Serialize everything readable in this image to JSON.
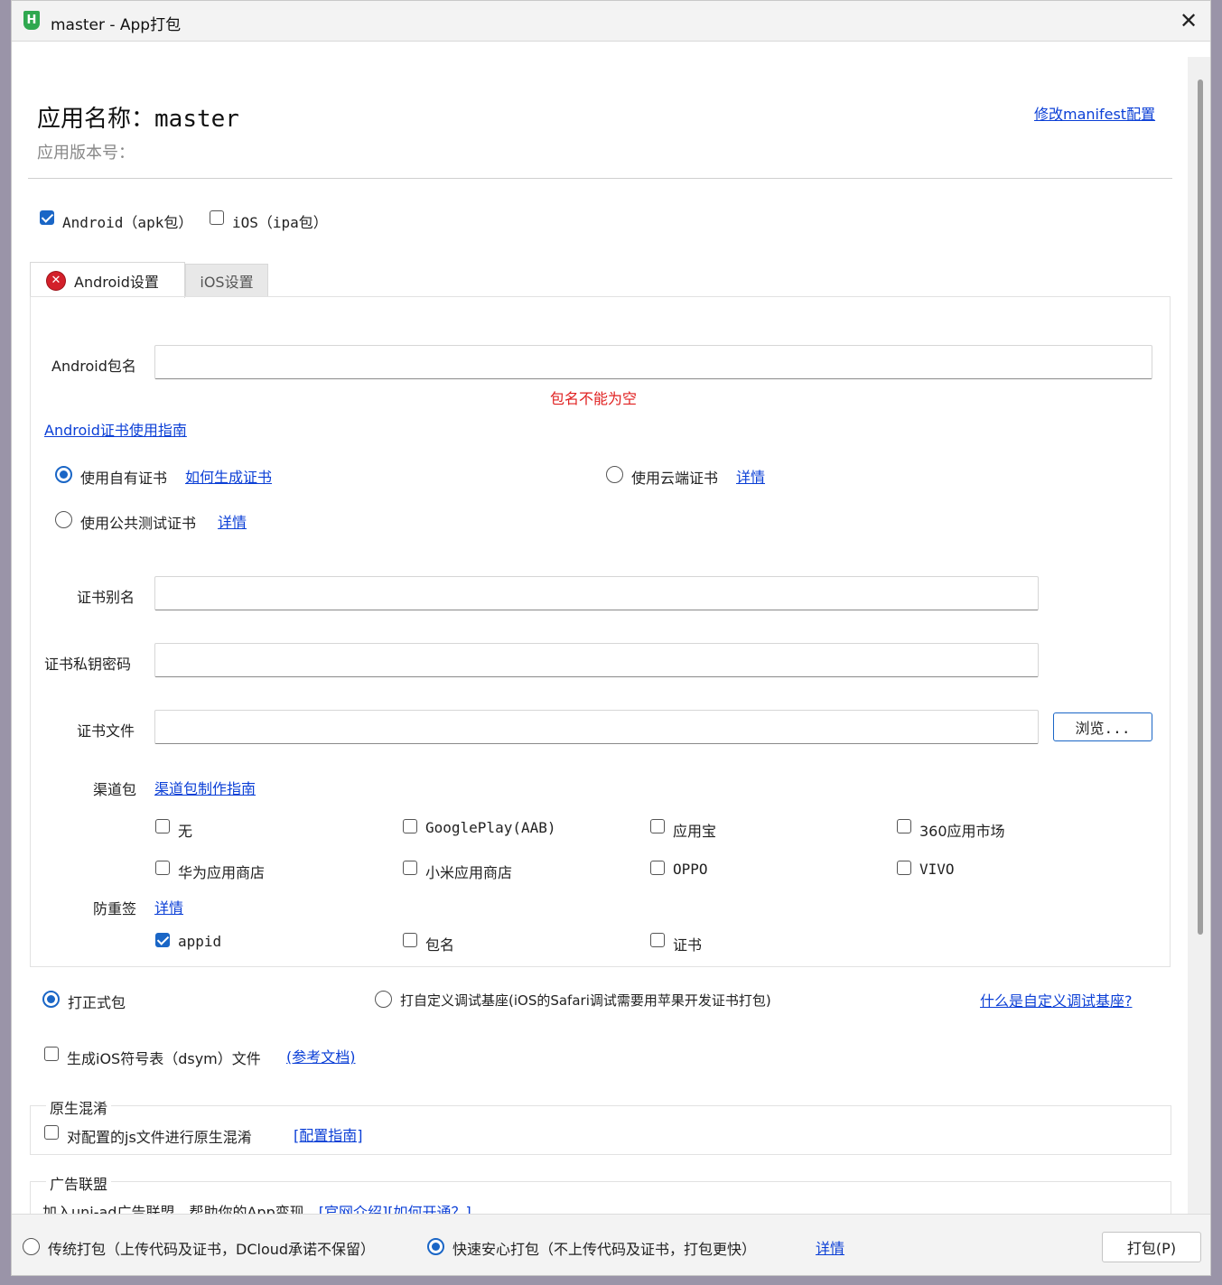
{
  "window": {
    "title": "master - App打包",
    "icon": "H",
    "close": "✕"
  },
  "header": {
    "app_name_label": "应用名称：",
    "app_name": "master",
    "version_label": "应用版本号：",
    "manifest_link": "修改manifest配置"
  },
  "platforms": {
    "android": {
      "label": "Android（apk包）",
      "checked": true
    },
    "ios": {
      "label": "iOS（ipa包）",
      "checked": false
    }
  },
  "tabs": [
    {
      "label": "Android设置",
      "active": true,
      "error_icon": "✕"
    },
    {
      "label": "iOS设置",
      "active": false
    }
  ],
  "android": {
    "package_label": "Android包名",
    "package_value": "",
    "package_error": "包名不能为空",
    "cert_guide_link": "Android证书使用指南",
    "cert_options": {
      "own": {
        "label": "使用自有证书",
        "link": "如何生成证书",
        "selected": true
      },
      "cloud": {
        "label": "使用云端证书",
        "link": "详情",
        "selected": false
      },
      "public": {
        "label": "使用公共测试证书",
        "link": "详情",
        "selected": false
      }
    },
    "alias_label": "证书别名",
    "password_label": "证书私钥密码",
    "file_label": "证书文件",
    "browse_button": "浏览...",
    "channel_label": "渠道包",
    "channel_link": "渠道包制作指南",
    "channels": [
      {
        "label": "无",
        "checked": false
      },
      {
        "label": "GooglePlay(AAB)",
        "checked": false
      },
      {
        "label": "应用宝",
        "checked": false
      },
      {
        "label": "360应用市场",
        "checked": false
      },
      {
        "label": "华为应用商店",
        "checked": false
      },
      {
        "label": "小米应用商店",
        "checked": false
      },
      {
        "label": "OPPO",
        "checked": false
      },
      {
        "label": "VIVO",
        "checked": false
      }
    ],
    "anti_resign_label": "防重签",
    "anti_resign_link": "详情",
    "anti_resign": [
      {
        "label": "appid",
        "checked": true
      },
      {
        "label": "包名",
        "checked": false
      },
      {
        "label": "证书",
        "checked": false
      }
    ]
  },
  "build_type": {
    "formal": {
      "label": "打正式包",
      "selected": true
    },
    "custom": {
      "label": "打自定义调试基座(iOS的Safari调试需要用苹果开发证书打包)",
      "selected": false
    },
    "custom_link": "什么是自定义调试基座?"
  },
  "dsym": {
    "label": "生成iOS符号表（dsym）文件",
    "link": "(参考文档)",
    "checked": false
  },
  "obfuscation": {
    "legend": "原生混淆",
    "label": "对配置的js文件进行原生混淆",
    "link": "[配置指南]",
    "checked": false
  },
  "ads": {
    "legend": "广告联盟",
    "text": "加入uni-ad广告联盟，帮助你的App变现。",
    "link1": "[官网介绍]",
    "link2": "[如何开通？]"
  },
  "footer": {
    "traditional": {
      "label": "传统打包（上传代码及证书，DCloud承诺不保留）",
      "selected": false
    },
    "fast": {
      "label": "快速安心打包（不上传代码及证书，打包更快）",
      "selected": true
    },
    "details_link": "详情",
    "pack_button": "打包(P)"
  }
}
